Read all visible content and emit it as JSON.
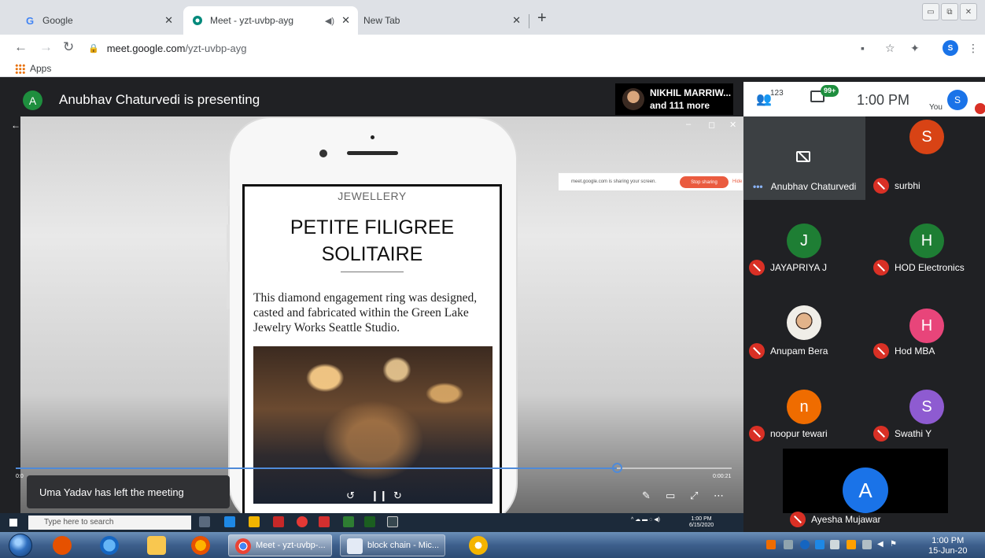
{
  "browser": {
    "tabs": [
      {
        "title": "Google",
        "favicon": "G"
      },
      {
        "title": "Meet - yzt-uvbp-ayg"
      },
      {
        "title": "New Tab"
      }
    ],
    "url_host": "meet.google.com",
    "url_path": "/yzt-uvbp-ayg",
    "profile_initial": "S",
    "bookmarks_apps": "Apps"
  },
  "meet": {
    "presenter_initial": "A",
    "presenting_title": "Anubhav Chaturvedi is presenting",
    "pinned_name": "NIKHIL MARRIW...",
    "pinned_more": "and 111 more",
    "people_count": "123",
    "chat_badge": "99+",
    "time": "1:00 PM",
    "you_label": "You",
    "you_initial": "S",
    "toast": "Uma Yadav has left the meeting",
    "participants": [
      {
        "name": "Anubhav Chaturvedi",
        "initial": "",
        "color": ""
      },
      {
        "name": "surbhi",
        "initial": "S",
        "color": "#d84315"
      },
      {
        "name": "JAYAPRIYA J",
        "initial": "J",
        "color": "#1e7e34"
      },
      {
        "name": "HOD Electronics",
        "initial": "H",
        "color": "#1e7e34"
      },
      {
        "name": "Anupam Bera",
        "initial": "",
        "color": ""
      },
      {
        "name": "Hod MBA",
        "initial": "H",
        "color": "#e8457a"
      },
      {
        "name": "noopur tewari",
        "initial": "n",
        "color": "#ef6c00"
      },
      {
        "name": "Swathi Y",
        "initial": "S",
        "color": "#8e5bd1"
      },
      {
        "name": "Ayesha Mujawar",
        "initial": "A",
        "color": "#1a73e8"
      }
    ]
  },
  "shared_screen": {
    "category": "JEWELLERY",
    "title_line1": "PETITE FILIGREE",
    "title_line2": "SOLITAIRE",
    "description": "This diamond engagement ring was designed, casted and fabricated within the Green Lake Jewelry Works Seattle Studio.",
    "share_notice": "meet.google.com is sharing your screen.",
    "stop_sharing": "Stop sharing",
    "hide": "Hide",
    "time_left": "0:0",
    "time_right": "0:00:21",
    "video_progress": 0.84,
    "remote_search_placeholder": "Type here to search",
    "remote_time": "1:00 PM",
    "remote_date": "6/15/2020"
  },
  "taskbar": {
    "tasks": [
      {
        "label": "Meet - yzt-uvbp-..."
      },
      {
        "label": "block chain - Mic..."
      }
    ],
    "clock_time": "1:00 PM",
    "clock_date": "15-Jun-20"
  }
}
